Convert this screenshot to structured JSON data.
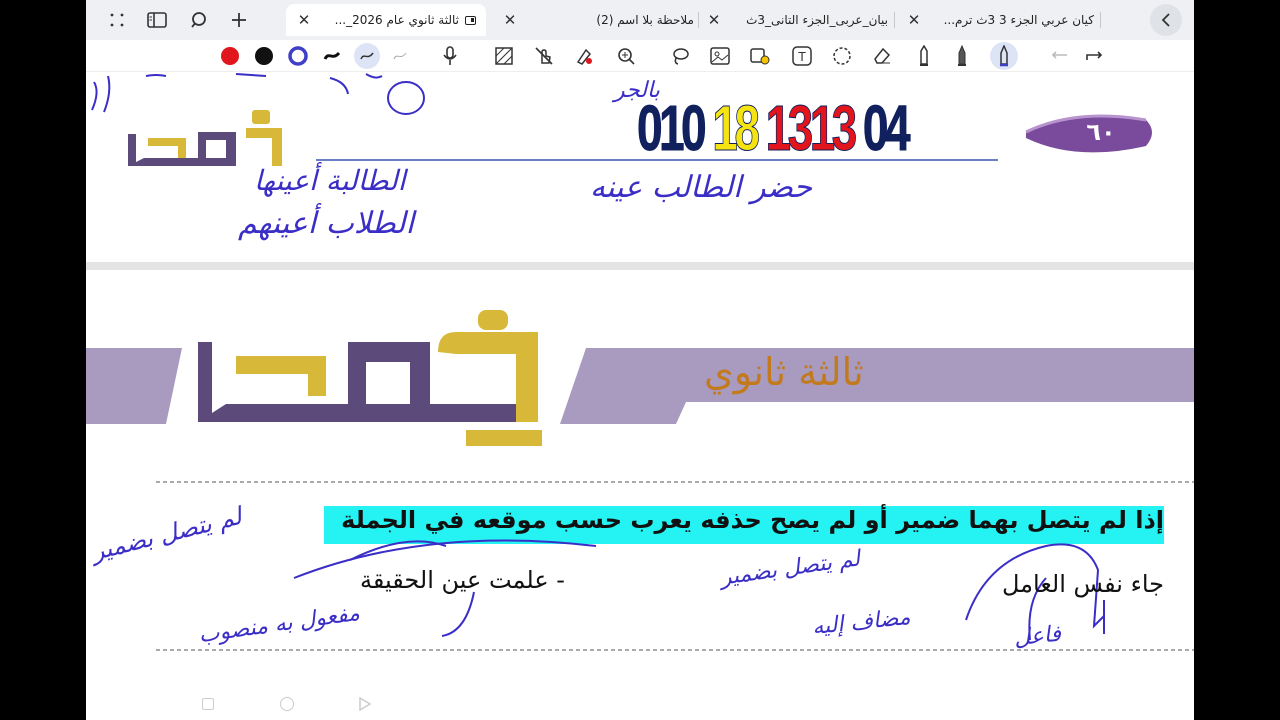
{
  "tabs": [
    {
      "title": "ثالثة ثانوي عام 2026_...",
      "active": true
    },
    {
      "title": "ملاحظة بلا اسم (2)",
      "active": false
    },
    {
      "title": "بيان_عربى_الجزء التانى_3ث",
      "active": false
    },
    {
      "title": "كيان عربي الجزء 3 3ث ترم...",
      "active": false
    }
  ],
  "toolbar": {
    "colors": [
      "#e0161c",
      "#111111",
      "#3f3fc8"
    ]
  },
  "page1": {
    "badge": "٦٠",
    "phone_parts": [
      {
        "text": "010",
        "color": "#10215e"
      },
      {
        "text": "18",
        "color": "#f5e312"
      },
      {
        "text": "1313",
        "color": "#e2141c"
      },
      {
        "text": "04",
        "color": "#10215e"
      }
    ],
    "logo": "خطبا",
    "handwriting": [
      "حضر الطالب عينه",
      "الطالبة أعينها",
      "الطلاب أعينهم",
      "بالجر"
    ]
  },
  "page2": {
    "logo": "خطبا",
    "grade": "ثالثة ثانوي",
    "rule": "إذا لم يتصل بهما ضمير أو لم يصح حذفه يعرب حسب موقعه في الجملة",
    "example1": "جاء نفس العامل",
    "example2": "- علمت عين الحقيقة",
    "handwriting": [
      "لم يتصل بضمير",
      "لم يتصل بضمير",
      "مفعول به منصوب",
      "مضاف إليه",
      "فاعل"
    ]
  }
}
